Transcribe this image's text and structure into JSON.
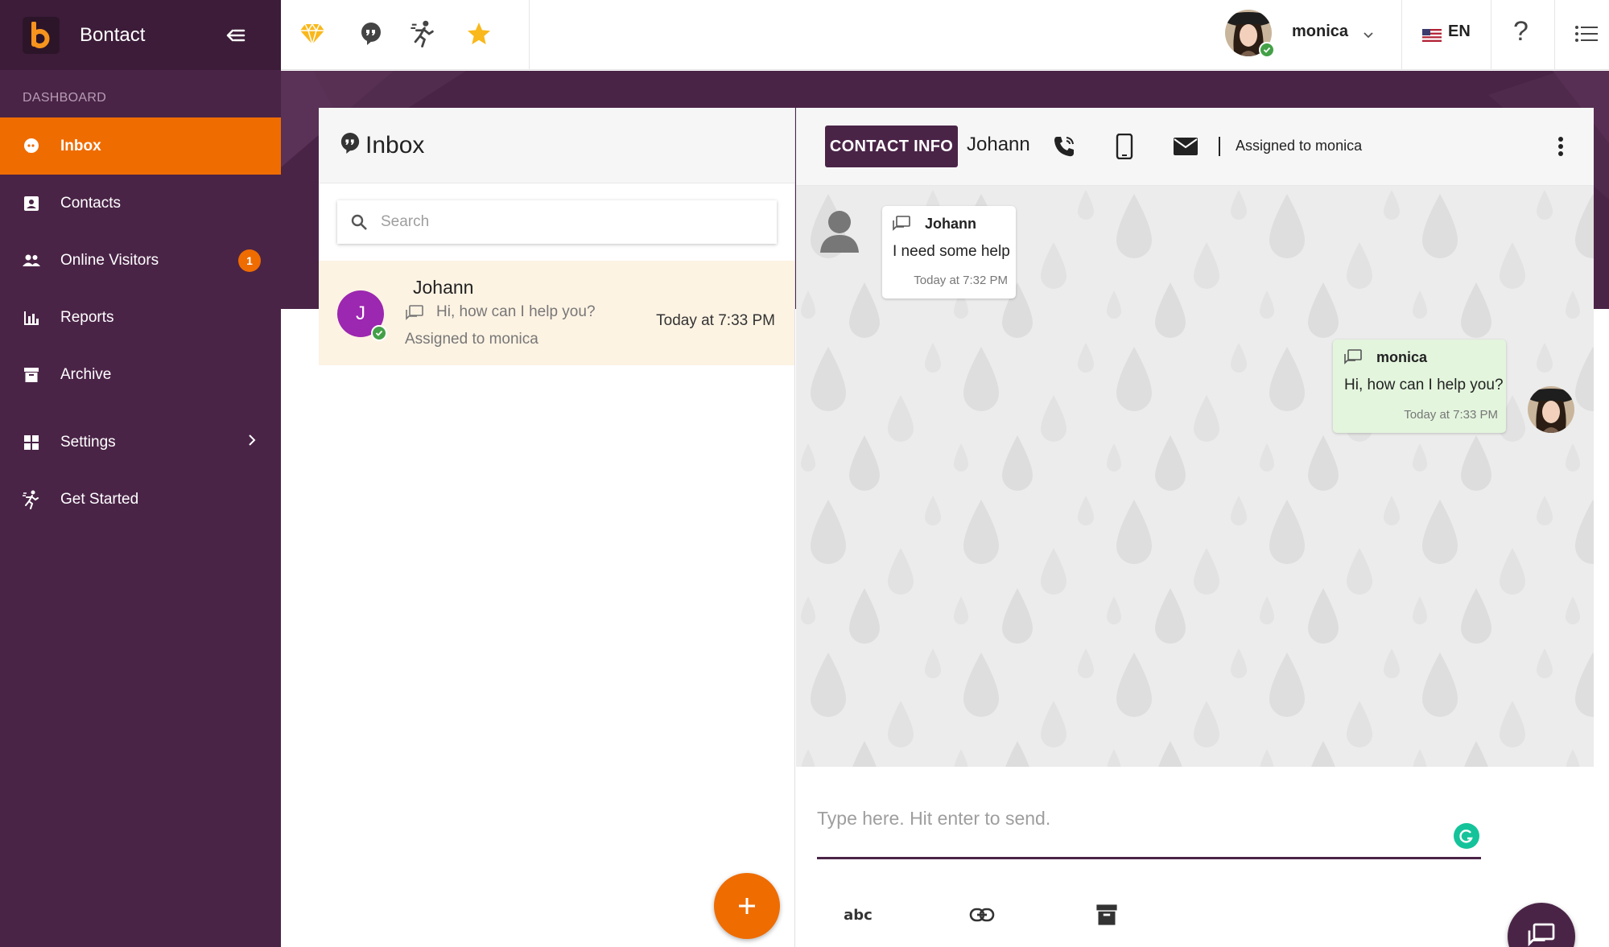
{
  "brand": {
    "name": "Bontact"
  },
  "sidebar": {
    "section_label": "DASHBOARD",
    "items": [
      {
        "label": "Inbox",
        "icon": "chat-bubble-icon",
        "active": true
      },
      {
        "label": "Contacts",
        "icon": "contact-card-icon"
      },
      {
        "label": "Online Visitors",
        "icon": "people-icon",
        "badge": "1"
      },
      {
        "label": "Reports",
        "icon": "bar-chart-icon"
      },
      {
        "label": "Archive",
        "icon": "archive-icon"
      },
      {
        "label": "Settings",
        "icon": "grid-icon"
      },
      {
        "label": "Get Started",
        "icon": "running-person-icon"
      }
    ]
  },
  "topbar": {
    "user_name": "monica",
    "language": "EN",
    "help": "?"
  },
  "inbox": {
    "title": "Inbox",
    "search_placeholder": "Search",
    "conversation": {
      "initial": "J",
      "name": "Johann",
      "last_message": "Hi, how can I help you?",
      "assigned": "Assigned to monica",
      "time": "Today at 7:33 PM"
    }
  },
  "chat": {
    "contact_info_label": "CONTACT INFO",
    "contact_name": "Johann",
    "assigned": "Assigned to monica",
    "messages": [
      {
        "author": "Johann",
        "text": "I need some help",
        "time": "Today at 7:32 PM",
        "direction": "incoming"
      },
      {
        "author": "monica",
        "text": "Hi, how can I help you?",
        "time": "Today at 7:33 PM",
        "direction": "outgoing"
      }
    ],
    "composer_placeholder": "Type here. Hit enter to send.",
    "tools": {
      "spellcheck_label": "abc"
    }
  },
  "colors": {
    "sidebar_bg": "#4a2447",
    "accent": "#ef6c00",
    "outgoing_bubble": "#e3f5dd",
    "online": "#43a047"
  }
}
